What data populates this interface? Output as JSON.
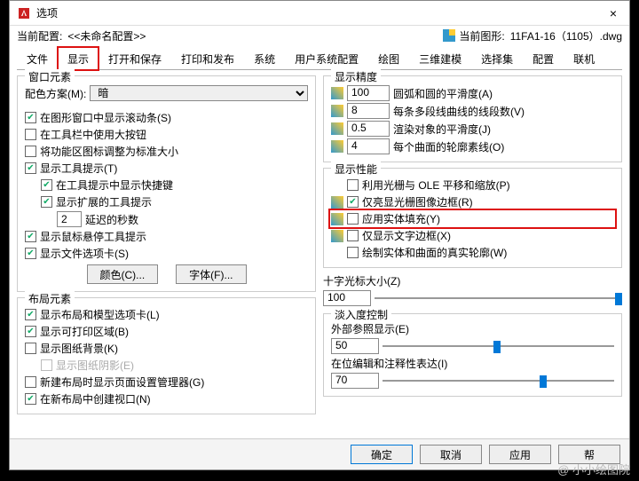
{
  "window": {
    "title": "选项",
    "close": "×"
  },
  "info": {
    "profileLabel": "当前配置:",
    "profileValue": "<<未命名配置>>",
    "drawingLabel": "当前图形:",
    "drawingValue": "11FA1-16（1105）.dwg"
  },
  "tabs": [
    "文件",
    "显示",
    "打开和保存",
    "打印和发布",
    "系统",
    "用户系统配置",
    "绘图",
    "三维建模",
    "选择集",
    "配置",
    "联机"
  ],
  "activeTab": 1,
  "left": {
    "g1": {
      "title": "窗口元素",
      "colorSchemeLabel": "配色方案(M):",
      "colorScheme": "暗",
      "c1": "在图形窗口中显示滚动条(S)",
      "c2": "在工具栏中使用大按钮",
      "c3": "将功能区图标调整为标准大小",
      "c4": "显示工具提示(T)",
      "c5": "在工具提示中显示快捷键",
      "c6": "显示扩展的工具提示",
      "delay": "2",
      "delayLabel": "延迟的秒数",
      "c7": "显示鼠标悬停工具提示",
      "c8": "显示文件选项卡(S)",
      "btnColor": "颜色(C)...",
      "btnFont": "字体(F)..."
    },
    "g2": {
      "title": "布局元素",
      "c1": "显示布局和模型选项卡(L)",
      "c2": "显示可打印区域(B)",
      "c3": "显示图纸背景(K)",
      "c4": "显示图纸阴影(E)",
      "c5": "新建布局时显示页面设置管理器(G)",
      "c6": "在新布局中创建视口(N)"
    }
  },
  "right": {
    "g1": {
      "title": "显示精度",
      "v1": "100",
      "t1": "圆弧和圆的平滑度(A)",
      "v2": "8",
      "t2": "每条多段线曲线的线段数(V)",
      "v3": "0.5",
      "t3": "渲染对象的平滑度(J)",
      "v4": "4",
      "t4": "每个曲面的轮廓素线(O)"
    },
    "g2": {
      "title": "显示性能",
      "c1": "利用光栅与 OLE 平移和缩放(P)",
      "c2": "仅亮显光栅图像边框(R)",
      "c3": "应用实体填充(Y)",
      "c4": "仅显示文字边框(X)",
      "c5": "绘制实体和曲面的真实轮廓(W)"
    },
    "cross": {
      "title": "十字光标大小(Z)",
      "val": "100"
    },
    "fade": {
      "title": "淡入度控制",
      "l1": "外部参照显示(E)",
      "v1": "50",
      "l2": "在位编辑和注释性表达(I)",
      "v2": "70"
    }
  },
  "buttons": {
    "ok": "确定",
    "cancel": "取消",
    "apply": "应用",
    "help": "帮"
  },
  "watermark": "@ 小小绘图院"
}
